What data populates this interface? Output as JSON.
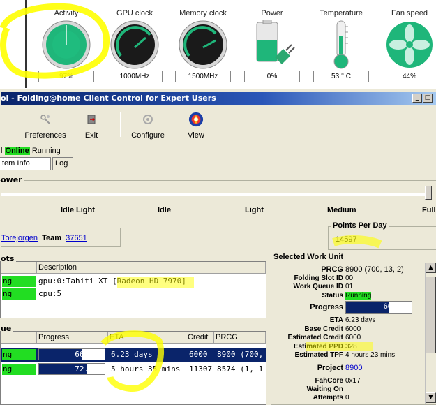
{
  "monitor": {
    "gauges": [
      {
        "label": "Activity",
        "value": "97%",
        "icon": "activity-gauge-icon"
      },
      {
        "label": "GPU clock",
        "value": "1000MHz",
        "icon": "gpu-clock-gauge-icon"
      },
      {
        "label": "Memory clock",
        "value": "1500MHz",
        "icon": "memory-clock-gauge-icon"
      },
      {
        "label": "Power",
        "value": "0%",
        "icon": "battery-plug-icon"
      },
      {
        "label": "Temperature",
        "value": "53 ° C",
        "icon": "thermometer-icon"
      },
      {
        "label": "Fan speed",
        "value": "44%",
        "icon": "fan-icon"
      }
    ]
  },
  "window": {
    "title": "ol - Folding@home Client Control for Expert Users",
    "controls": [
      "_",
      "□",
      "×"
    ]
  },
  "toolbar": {
    "items": [
      {
        "label": "Preferences",
        "icon": "preferences-icon"
      },
      {
        "label": "Exit",
        "icon": "exit-icon"
      },
      {
        "label": "Configure",
        "icon": "configure-icon"
      },
      {
        "label": "View",
        "icon": "view-globe-icon"
      }
    ]
  },
  "status": {
    "prefix": "l",
    "online": "Online",
    "state": "Running"
  },
  "tabs": [
    {
      "label": "tem Info"
    },
    {
      "label": "Log"
    }
  ],
  "power": {
    "legend": "ower",
    "level_fraction": 1.0,
    "labels": [
      "Idle Light",
      "Idle",
      "Light",
      "Medium",
      "Full"
    ]
  },
  "identity": {
    "user": "Torejorgen",
    "team_label": "Team",
    "team": "37651"
  },
  "points_per_day": {
    "legend": "Points Per Day",
    "value": "14597"
  },
  "slots": {
    "legend": "ots",
    "headers": [
      "",
      "Description"
    ],
    "rows": [
      {
        "status": "ng",
        "description": "gpu:0:Tahiti XT [Radeon HD 7970]"
      },
      {
        "status": "ng",
        "description": "cpu:5"
      }
    ]
  },
  "queue": {
    "legend": "ue",
    "headers": [
      "",
      "Progress",
      "ETA",
      "Credit",
      "PRCG"
    ],
    "rows": [
      {
        "status": "ng",
        "progress": "66.01%",
        "progress_fraction": 0.6601,
        "eta": "6.23 days",
        "credit": "6000",
        "prcg": "8900 (700,"
      },
      {
        "status": "ng",
        "progress": "72.75%",
        "progress_fraction": 0.7275,
        "eta": "5 hours 35 mins",
        "credit": "11307",
        "prcg": "8574 (1, 1"
      }
    ]
  },
  "selected_wu": {
    "legend": "Selected Work Unit",
    "prcg_label": "PRCG",
    "prcg": "8900 (700, 13, 2)",
    "slot_label": "Folding Slot ID",
    "slot": "00",
    "queue_label": "Work Queue ID",
    "queue": "01",
    "status_label": "Status",
    "status": "Running",
    "progress_label": "Progress",
    "progress": "66.01%",
    "progress_fraction": 0.6601,
    "eta_label": "ETA",
    "eta": "6.23 days",
    "base_credit_label": "Base Credit",
    "base_credit": "6000",
    "est_credit_label": "Estimated Credit",
    "est_credit": "6000",
    "est_ppd_label": "Estimated PPD",
    "est_ppd": "328",
    "est_tpf_label": "Estimated TPF",
    "est_tpf": "4 hours 23 mins",
    "project_label": "Project",
    "project": "8900",
    "fahcore_label": "FahCore",
    "fahcore": "0x17",
    "waiting_label": "Waiting On",
    "waiting": "",
    "attempts_label": "Attempts",
    "attempts": "0"
  },
  "colors": {
    "online": "#22dd22",
    "titlebar": "#0a246a",
    "selection": "#0a246a",
    "gauge_green": "#1fb67a",
    "highlight": "#ffff00"
  }
}
